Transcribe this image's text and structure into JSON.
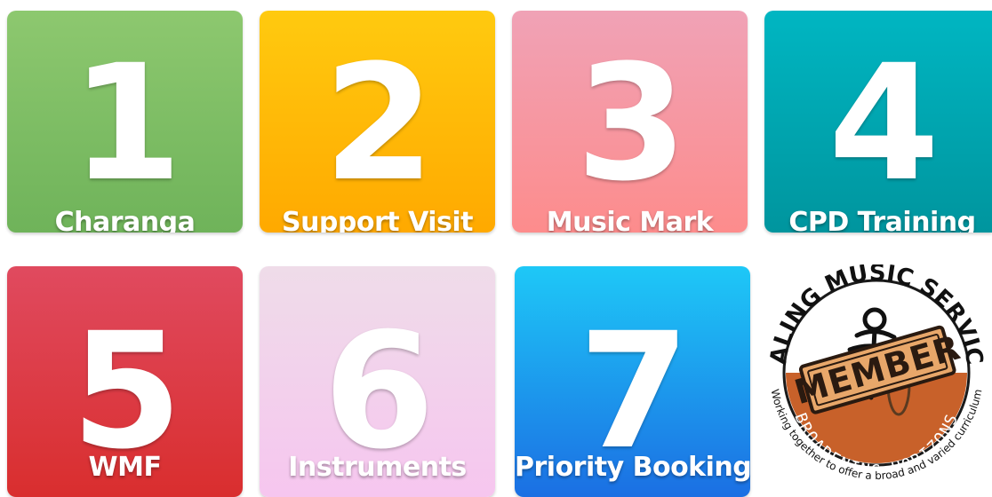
{
  "tiles": [
    {
      "number": "1",
      "label": "Charanga",
      "top": "#8dc86f",
      "bottom": "#6fb35a"
    },
    {
      "number": "2",
      "label": "Support Visit",
      "top": "#ffca0f",
      "bottom": "#ffa900"
    },
    {
      "number": "3",
      "label": "Music Mark",
      "top": "#f0a2b6",
      "bottom": "#fd8c8c"
    },
    {
      "number": "4",
      "label": "CPD Training",
      "top": "#00b6c2",
      "bottom": "#00959e"
    },
    {
      "number": "5",
      "label": "WMF",
      "top": "#e04a5f",
      "bottom": "#d92e2e"
    },
    {
      "number": "6",
      "label": "Instruments",
      "top": "#efdce9",
      "bottom": "#f6c6ef"
    },
    {
      "number": "7",
      "label": "Priority Booking",
      "top": "#1ec8f7",
      "bottom": "#1b6fe3"
    }
  ],
  "badge": {
    "top_text": "EALING MUSIC SERVICE",
    "stamp_text": "MEMBER",
    "bottom_text": "BROADENING HORIZONS",
    "tagline": "Working together to offer a broad and varied curriculum",
    "orange": "#c8612a",
    "stamp_fill": "#e8a76a"
  }
}
